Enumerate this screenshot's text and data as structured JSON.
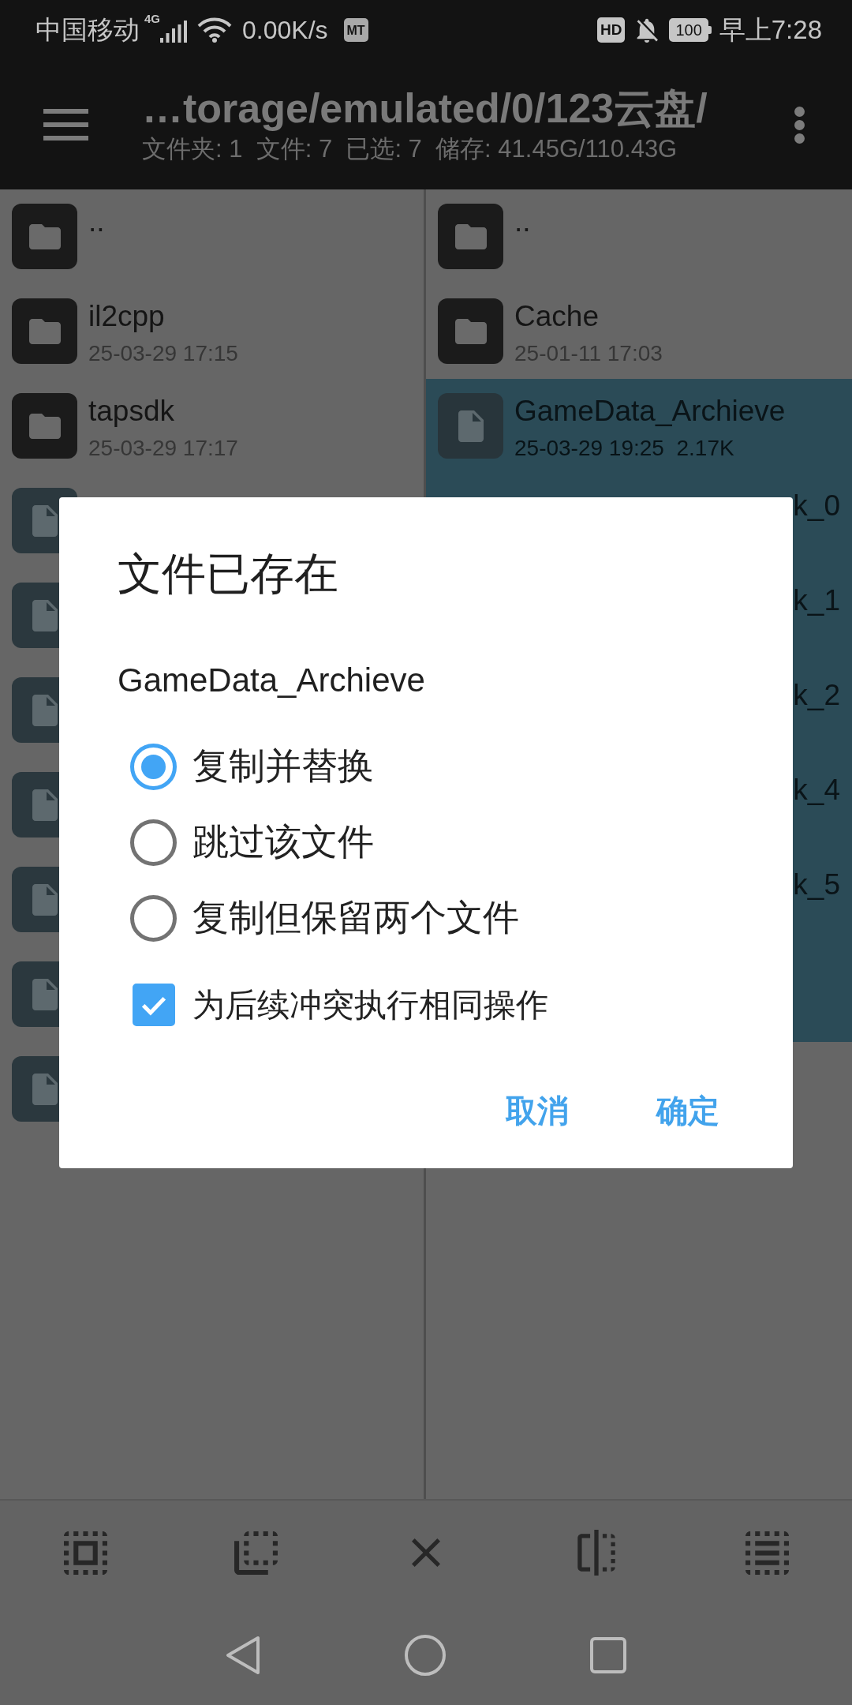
{
  "status_bar": {
    "carrier": "中国移动",
    "network": "4G",
    "speed": "0.00K/s",
    "app_badge": "MT",
    "hd_badge": "HD",
    "battery": "100",
    "time": "早上7:28"
  },
  "header": {
    "path": "…torage/emulated/0/123云盘/",
    "summary": "文件夹: 1  文件: 7  已选: 7  储存: 41.45G/110.43G"
  },
  "panes": [
    {
      "items": [
        {
          "kind": "folder",
          "name": "..",
          "selected": false
        },
        {
          "kind": "folder",
          "name": "il2cpp",
          "meta": "25-03-29 17:15",
          "selected": false
        },
        {
          "kind": "folder",
          "name": "tapsdk",
          "meta": "25-03-29 17:17",
          "selected": false
        },
        {
          "kind": "file",
          "selected": false
        },
        {
          "kind": "file",
          "selected": false
        },
        {
          "kind": "file",
          "selected": false
        },
        {
          "kind": "file",
          "selected": false
        },
        {
          "kind": "file",
          "selected": false
        },
        {
          "kind": "file",
          "selected": false
        },
        {
          "kind": "file",
          "selected": false
        }
      ]
    },
    {
      "items": [
        {
          "kind": "folder",
          "name": "..",
          "selected": false
        },
        {
          "kind": "folder",
          "name": "Cache",
          "meta": "25-01-11 17:03",
          "selected": false
        },
        {
          "kind": "file",
          "name": "GameData_Archieve",
          "meta": "25-03-29 19:25  2.17K",
          "selected": true
        },
        {
          "name": "k_0",
          "selected": true
        },
        {
          "name": "k_1",
          "selected": true
        },
        {
          "name": "k_2",
          "selected": true
        },
        {
          "name": "k_4",
          "selected": true
        },
        {
          "name": "k_5",
          "selected": true
        },
        {
          "selected": true
        }
      ]
    }
  ],
  "dialog": {
    "title": "文件已存在",
    "filename": "GameData_Archieve",
    "options": [
      {
        "label": "复制并替换",
        "selected": true
      },
      {
        "label": "跳过该文件",
        "selected": false
      },
      {
        "label": "复制但保留两个文件",
        "selected": false
      }
    ],
    "apply_to_all": {
      "label": "为后续冲突执行相同操作",
      "checked": true
    },
    "buttons": [
      "取消",
      "确定"
    ]
  }
}
